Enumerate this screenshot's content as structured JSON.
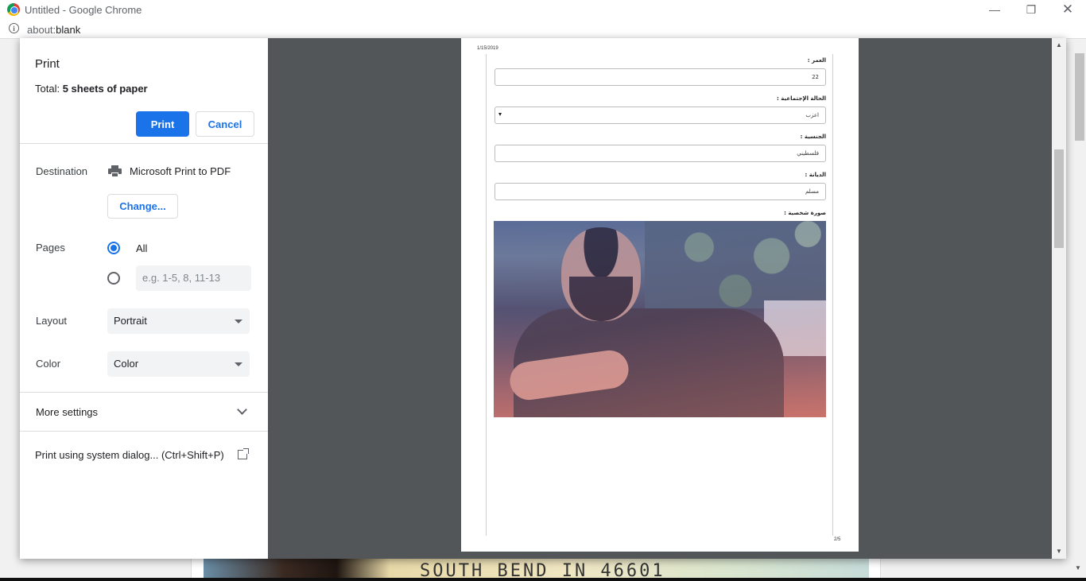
{
  "window": {
    "title": "Untitled - Google Chrome",
    "minimize": "—",
    "maximize": "❐",
    "close": "✕"
  },
  "address": {
    "scheme": "about:",
    "host": "blank"
  },
  "background_page": {
    "card_text": "SOUTH BEND IN 46601"
  },
  "print_dialog": {
    "title": "Print",
    "total_prefix": "Total: ",
    "total_value": "5 sheets of paper",
    "print_button": "Print",
    "cancel_button": "Cancel",
    "destination": {
      "label": "Destination",
      "printer": "Microsoft Print to PDF",
      "change_button": "Change..."
    },
    "pages": {
      "label": "Pages",
      "all_label": "All",
      "all_selected": true,
      "custom_placeholder": "e.g. 1-5, 8, 11-13"
    },
    "layout": {
      "label": "Layout",
      "value": "Portrait"
    },
    "color": {
      "label": "Color",
      "value": "Color"
    },
    "more_settings": "More settings",
    "system_dialog": "Print using system dialog... (Ctrl+Shift+P)"
  },
  "preview": {
    "date": "1/15/2019",
    "page_number": "2/5",
    "fields": [
      {
        "label": "العمر :",
        "value": "22"
      },
      {
        "label": "الحالة الإجتماعية :",
        "value": "اعزب"
      },
      {
        "label": "الجنسية :",
        "value": "فلسطيني"
      },
      {
        "label": "الديانة :",
        "value": "مسلم"
      }
    ],
    "photo_label": "صورة شخصية :"
  }
}
